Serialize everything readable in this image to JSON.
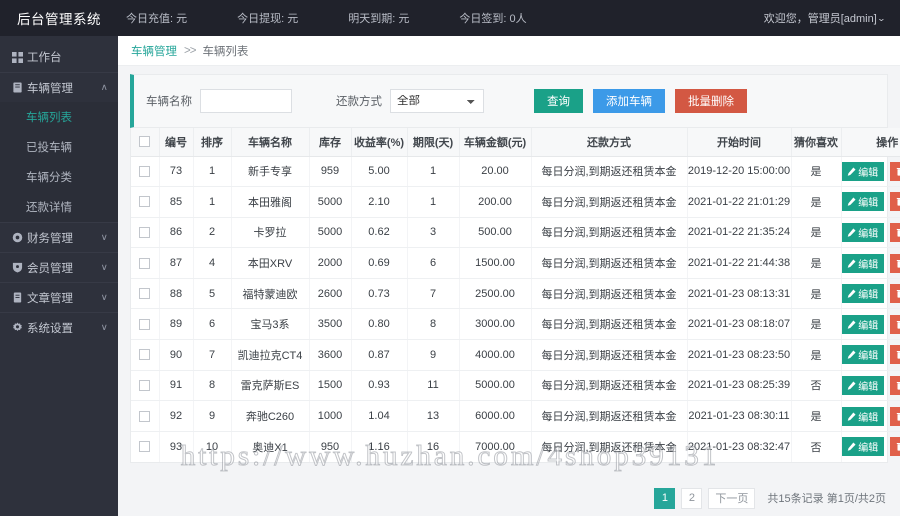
{
  "topbar": {
    "brand": "后台管理系统",
    "stats": [
      "今日充值: 元",
      "今日提现: 元",
      "明天到期: 元",
      "今日签到: 0人"
    ],
    "user": "欢迎您，管理员[admin]",
    "user_caret": "⌄"
  },
  "sidebar": {
    "items": [
      {
        "label": "工作台",
        "icon": "dashboard-icon",
        "arrow": ""
      },
      {
        "label": "车辆管理",
        "icon": "book-icon",
        "arrow": "∧"
      },
      {
        "label": "财务管理",
        "icon": "coin-icon",
        "arrow": "∨"
      },
      {
        "label": "会员管理",
        "icon": "user-shield-icon",
        "arrow": "∨"
      },
      {
        "label": "文章管理",
        "icon": "doc-icon",
        "arrow": "∨"
      },
      {
        "label": "系统设置",
        "icon": "gear-icon",
        "arrow": "∨"
      }
    ],
    "submenu": [
      {
        "label": "车辆列表",
        "active": true
      },
      {
        "label": "已投车辆",
        "active": false
      },
      {
        "label": "车辆分类",
        "active": false
      },
      {
        "label": "还款详情",
        "active": false
      }
    ]
  },
  "breadcrumb": {
    "parent": "车辆管理",
    "separator": ">>",
    "current": "车辆列表"
  },
  "filter": {
    "name_label": "车辆名称",
    "name_value": "",
    "name_placeholder": "",
    "repay_label": "还款方式",
    "repay_value": "全部",
    "repay_options": [
      "全部"
    ],
    "search_button": "查询",
    "add_button": "添加车辆",
    "batch_delete_button": "批量删除"
  },
  "table": {
    "headers": [
      "",
      "编号",
      "排序",
      "车辆名称",
      "库存",
      "收益率(%)",
      "期限(天)",
      "车辆金额(元)",
      "还款方式",
      "开始时间",
      "猜你喜欢",
      "操作"
    ],
    "edit_label": "编辑",
    "delete_label": "删除",
    "rows": [
      {
        "id": "73",
        "sort": "1",
        "name": "新手专享",
        "stock": "959",
        "rate": "5.00",
        "term": "1",
        "amount": "20.00",
        "repay": "每日分润,到期返还租赁本金",
        "time": "2019-12-20 15:00:00",
        "like": "是"
      },
      {
        "id": "85",
        "sort": "1",
        "name": "本田雅阁",
        "stock": "5000",
        "rate": "2.10",
        "term": "1",
        "amount": "200.00",
        "repay": "每日分润,到期返还租赁本金",
        "time": "2021-01-22 21:01:29",
        "like": "是"
      },
      {
        "id": "86",
        "sort": "2",
        "name": "卡罗拉",
        "stock": "5000",
        "rate": "0.62",
        "term": "3",
        "amount": "500.00",
        "repay": "每日分润,到期返还租赁本金",
        "time": "2021-01-22 21:35:24",
        "like": "是"
      },
      {
        "id": "87",
        "sort": "4",
        "name": "本田XRV",
        "stock": "2000",
        "rate": "0.69",
        "term": "6",
        "amount": "1500.00",
        "repay": "每日分润,到期返还租赁本金",
        "time": "2021-01-22 21:44:38",
        "like": "是"
      },
      {
        "id": "88",
        "sort": "5",
        "name": "福特蒙迪欧",
        "stock": "2600",
        "rate": "0.73",
        "term": "7",
        "amount": "2500.00",
        "repay": "每日分润,到期返还租赁本金",
        "time": "2021-01-23 08:13:31",
        "like": "是"
      },
      {
        "id": "89",
        "sort": "6",
        "name": "宝马3系",
        "stock": "3500",
        "rate": "0.80",
        "term": "8",
        "amount": "3000.00",
        "repay": "每日分润,到期返还租赁本金",
        "time": "2021-01-23 08:18:07",
        "like": "是"
      },
      {
        "id": "90",
        "sort": "7",
        "name": "凯迪拉克CT4",
        "stock": "3600",
        "rate": "0.87",
        "term": "9",
        "amount": "4000.00",
        "repay": "每日分润,到期返还租赁本金",
        "time": "2021-01-23 08:23:50",
        "like": "是"
      },
      {
        "id": "91",
        "sort": "8",
        "name": "雷克萨斯ES",
        "stock": "1500",
        "rate": "0.93",
        "term": "11",
        "amount": "5000.00",
        "repay": "每日分润,到期返还租赁本金",
        "time": "2021-01-23 08:25:39",
        "like": "否"
      },
      {
        "id": "92",
        "sort": "9",
        "name": "奔驰C260",
        "stock": "1000",
        "rate": "1.04",
        "term": "13",
        "amount": "6000.00",
        "repay": "每日分润,到期返还租赁本金",
        "time": "2021-01-23 08:30:11",
        "like": "是"
      },
      {
        "id": "93",
        "sort": "10",
        "name": "奥迪X1",
        "stock": "950",
        "rate": "1.16",
        "term": "16",
        "amount": "7000.00",
        "repay": "每日分润,到期返还租赁本金",
        "time": "2021-01-23 08:32:47",
        "like": "否"
      }
    ]
  },
  "pagination": {
    "pages": [
      "1",
      "2"
    ],
    "current": "1",
    "next_label": "下一页",
    "info": "共15条记录 第1页/共2页"
  },
  "watermark": "https://www.huzhan.com/4shop39131",
  "colors": {
    "accent_teal": "#26a69a",
    "button_blue": "#3c9ae8",
    "button_red": "#d35843",
    "sidebar_bg": "#2e313c",
    "topbar_bg": "#20222b"
  }
}
